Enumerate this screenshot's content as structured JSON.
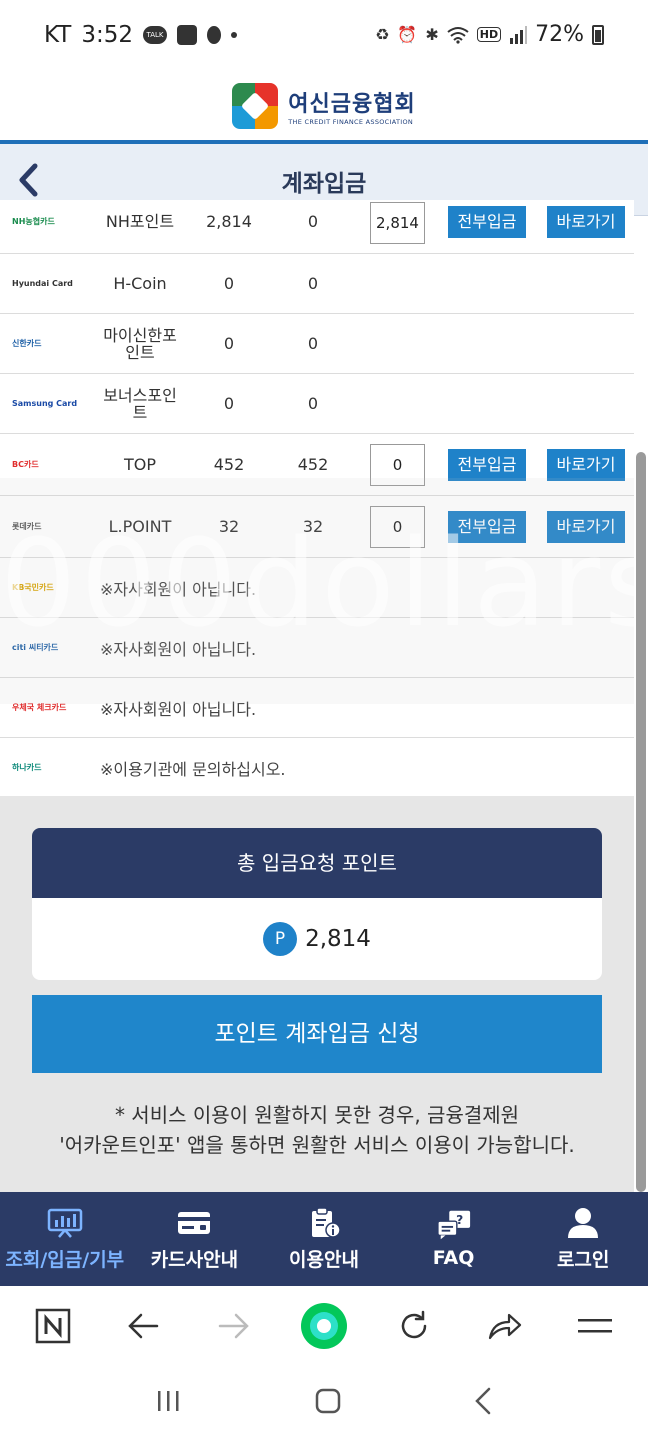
{
  "status_bar": {
    "carrier": "KT",
    "time": "3:52",
    "battery": "72%",
    "talk_icon_label": "TALK",
    "hd_label": "HD"
  },
  "header": {
    "logo_ko": "여신금융협회",
    "logo_en": "THE CREDIT FINANCE ASSOCIATION",
    "page_title": "계좌입금"
  },
  "table": {
    "rows": [
      {
        "logo": "NH농협카드",
        "logo_color": "#1a8c4e",
        "name": "NH포인트",
        "points": "2,814",
        "available": "0",
        "input": "2,814",
        "btn_all": "전부입금",
        "btn_go": "바로가기"
      },
      {
        "logo": "Hyundai Card",
        "logo_color": "#333333",
        "name": "H-Coin",
        "points": "0",
        "available": "0"
      },
      {
        "logo": "신한카드",
        "logo_color": "#1d5fa6",
        "name": "마이신한포인트",
        "points": "0",
        "available": "0"
      },
      {
        "logo": "Samsung Card",
        "logo_color": "#1a4aa6",
        "name": "보너스포인트",
        "points": "0",
        "available": "0"
      },
      {
        "logo": "BC카드",
        "logo_color": "#e02d2d",
        "name": "TOP",
        "points": "452",
        "available": "452",
        "input": "0",
        "btn_all": "전부입금",
        "btn_go": "바로가기"
      },
      {
        "logo": "롯데카드",
        "logo_color": "#555555",
        "name": "L.POINT",
        "points": "32",
        "available": "32",
        "input": "0",
        "btn_all": "전부입금",
        "btn_go": "바로가기"
      },
      {
        "logo": "KB국민카드",
        "logo_color": "#d9a300",
        "message": "※자사회원이 아닙니다."
      },
      {
        "logo": "citi 씨티카드",
        "logo_color": "#1d5fa6",
        "message": "※자사회원이 아닙니다."
      },
      {
        "logo": "우체국 체크카드",
        "logo_color": "#e02d2d",
        "message": "※자사회원이 아닙니다."
      },
      {
        "logo": "하나카드",
        "logo_color": "#0e8a7a",
        "message": "※이용기관에 문의하십시오."
      }
    ]
  },
  "watermark_text": "000dollars",
  "total": {
    "heading": "총 입금요청 포인트",
    "badge": "P",
    "value": "2,814"
  },
  "apply_button": "포인트 계좌입금 신청",
  "note": {
    "line1": "* 서비스 이용이 원활하지 못한 경우, 금융결제원",
    "line2": "'어카운트인포' 앱을 통하면 원활한 서비스 이용이 가능합니다."
  },
  "bottom_nav": [
    {
      "label": "조회/입금/기부",
      "icon": "chart-board-icon",
      "active": true
    },
    {
      "label": "카드사안내",
      "icon": "card-icon",
      "active": false
    },
    {
      "label": "이용안내",
      "icon": "clipboard-info-icon",
      "active": false
    },
    {
      "label": "FAQ",
      "icon": "chat-question-icon",
      "active": false
    },
    {
      "label": "로그인",
      "icon": "user-icon",
      "active": false
    }
  ],
  "colors": {
    "brand_navy": "#2b3b66",
    "button_blue": "#1f82c9",
    "active_nav": "#7db4ff",
    "naver_green": "#03c75a"
  }
}
